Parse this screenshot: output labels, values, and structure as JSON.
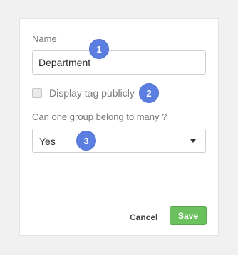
{
  "form": {
    "name_label": "Name",
    "name_value": "Department",
    "checkbox_label": "Display tag publicly",
    "checkbox_checked": false,
    "question_label": "Can one group belong to many ?",
    "select_value": "Yes",
    "cancel_label": "Cancel",
    "save_label": "Save"
  },
  "badges": {
    "one": "1",
    "two": "2",
    "three": "3"
  },
  "colors": {
    "save_button": "#6cc15f",
    "badge": "#5b7fe0"
  },
  "icons": {
    "select_caret": "caret-down-icon"
  }
}
